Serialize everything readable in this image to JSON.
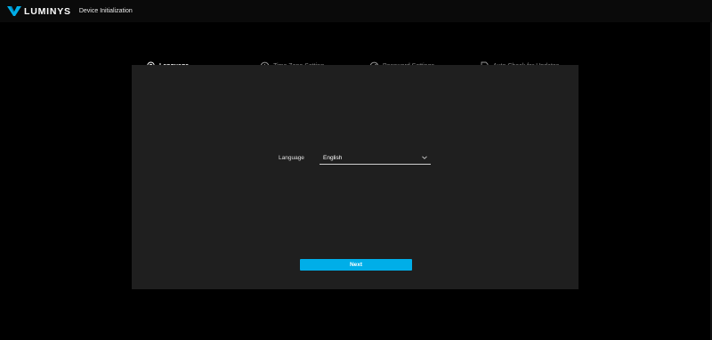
{
  "header": {
    "brand": "LUMINYS",
    "app_title": "Device Initialization",
    "logo_icon": "luminys-v-logo",
    "accent_color": "#00aee8"
  },
  "stepper": {
    "steps": [
      {
        "label": "Language",
        "icon": "location-pin-icon",
        "state": "active"
      },
      {
        "label": "Time Zone Setting",
        "icon": "clock-icon",
        "state": "inactive"
      },
      {
        "label": "Password Settings",
        "icon": "compass-icon",
        "state": "inactive"
      },
      {
        "label": "Auto Check for Updates",
        "icon": "document-search-icon",
        "state": "inactive"
      }
    ]
  },
  "form": {
    "language_label": "Language",
    "language_value": "English",
    "dropdown_icon": "chevron-down-icon",
    "next_label": "Next"
  }
}
